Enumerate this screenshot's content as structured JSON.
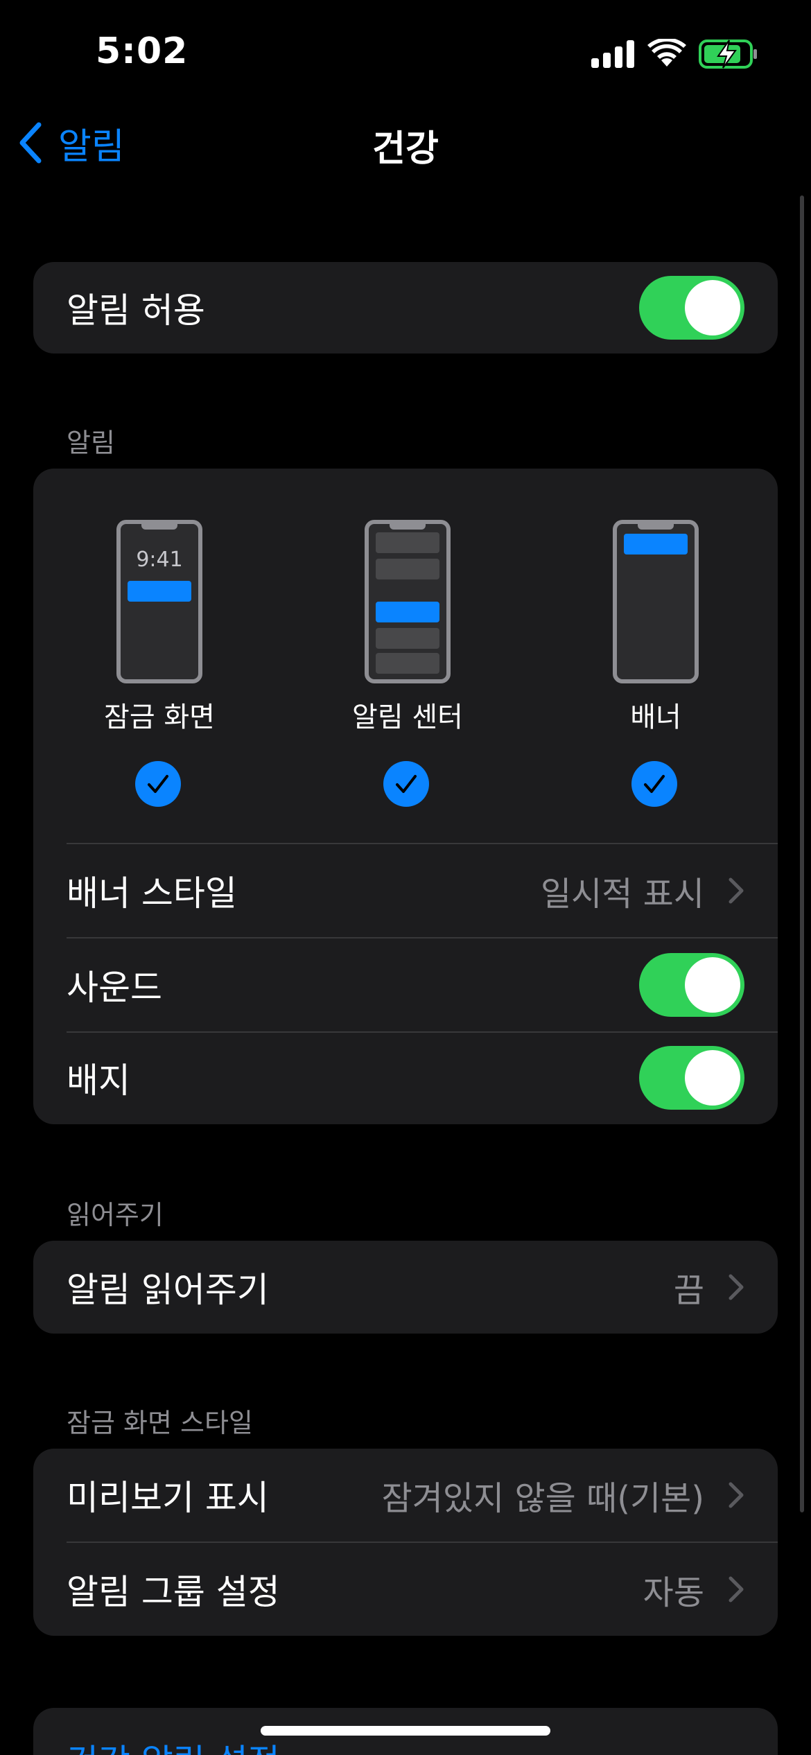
{
  "status_bar": {
    "time": "5:02"
  },
  "nav": {
    "back_label": "알림",
    "title": "건강"
  },
  "allow_notifications": {
    "label": "알림 허용",
    "enabled": true
  },
  "alerts_section": {
    "header": "알림",
    "previews": [
      {
        "label": "잠금 화면",
        "time": "9:41",
        "checked": true
      },
      {
        "label": "알림 센터",
        "checked": true
      },
      {
        "label": "배너",
        "checked": true
      }
    ],
    "banner_style": {
      "label": "배너 스타일",
      "value": "일시적 표시"
    },
    "sounds": {
      "label": "사운드",
      "enabled": true
    },
    "badges": {
      "label": "배지",
      "enabled": true
    }
  },
  "announce_section": {
    "header": "읽어주기",
    "announce": {
      "label": "알림 읽어주기",
      "value": "끔"
    }
  },
  "lock_screen_section": {
    "header": "잠금 화면 스타일",
    "show_previews": {
      "label": "미리보기 표시",
      "value": "잠겨있지 않을 때(기본)"
    },
    "grouping": {
      "label": "알림 그룹 설정",
      "value": "자동"
    }
  },
  "health_settings": {
    "label": "건강 알림 설정"
  },
  "colors": {
    "accent": "#0a84ff",
    "toggle_on": "#30d158",
    "group_bg": "#1c1c1e",
    "secondary_text": "#8e8e93"
  }
}
